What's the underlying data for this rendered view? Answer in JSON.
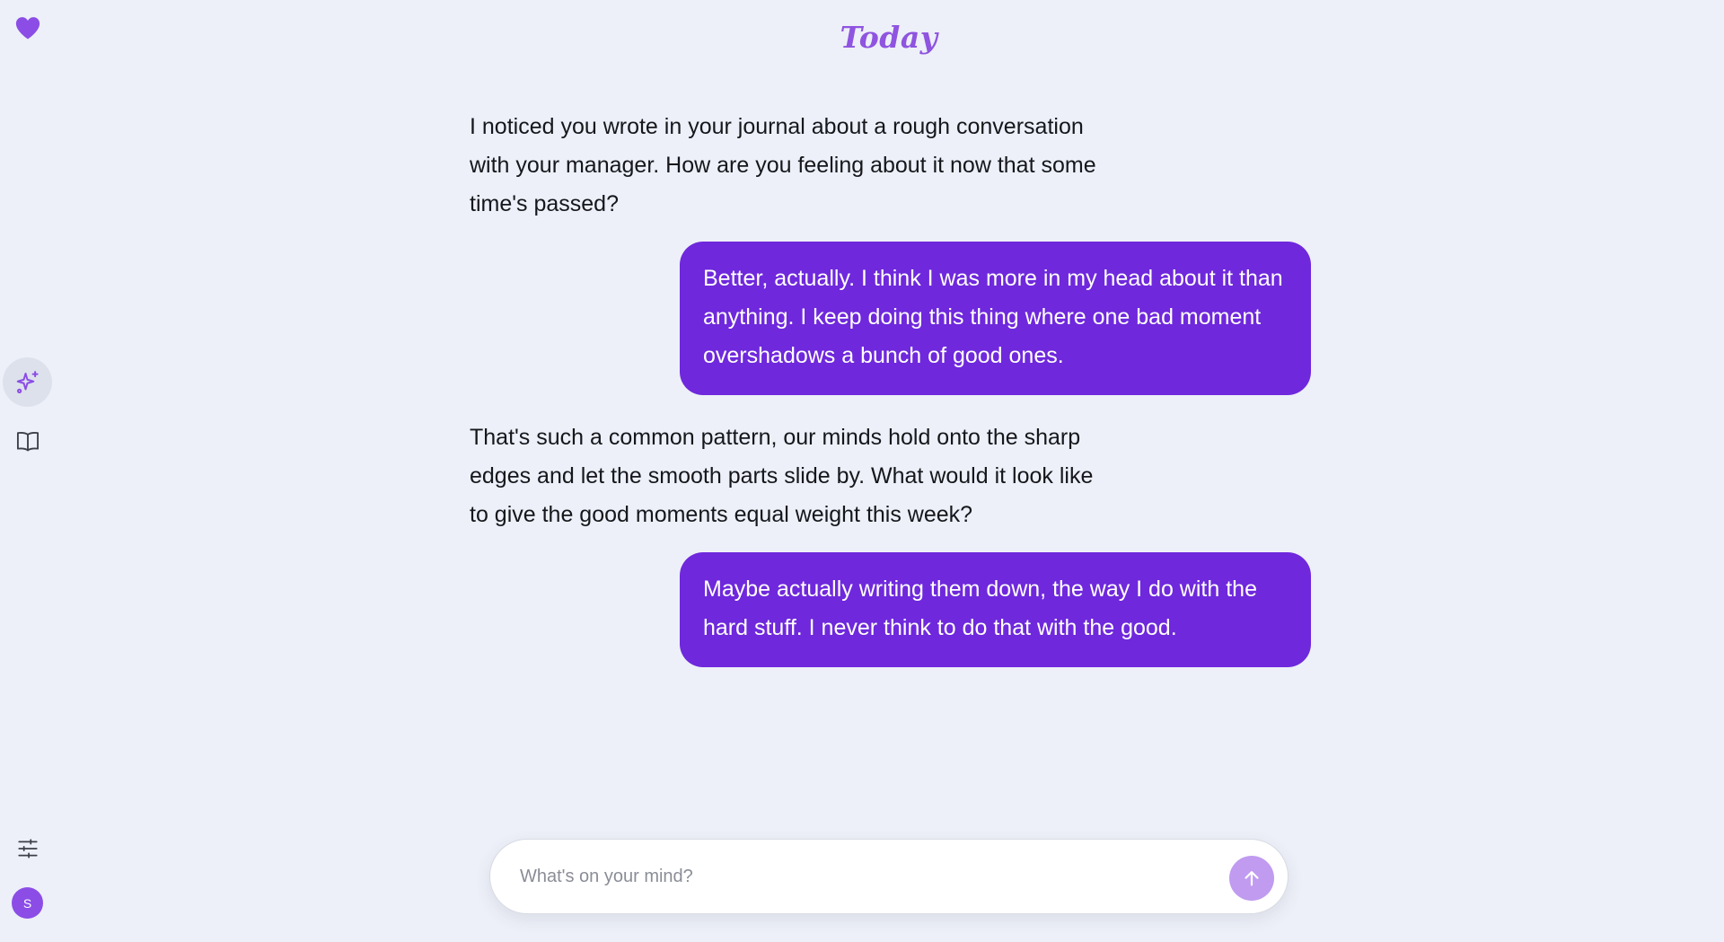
{
  "sidebar": {
    "logo_icon": "heart-icon",
    "nav": [
      {
        "icon": "sparkles-icon",
        "active": true
      },
      {
        "icon": "book-icon",
        "active": false
      }
    ],
    "settings_icon": "sliders-icon",
    "avatar_initial": "S"
  },
  "header": {
    "title": "Today"
  },
  "messages": [
    {
      "role": "assistant",
      "text": "I noticed you wrote in your journal about a rough conversation with your manager. How are you feeling about it now that some time's passed?"
    },
    {
      "role": "user",
      "text": "Better, actually. I think I was more in my head about it than anything. I keep doing this thing where one bad moment overshadows a bunch of good ones."
    },
    {
      "role": "assistant",
      "text": "That's such a common pattern, our minds hold onto the sharp edges and let the smooth parts slide by. What would it look like to give the good moments equal weight this week?"
    },
    {
      "role": "user",
      "text": "Maybe actually writing them down, the way I do with the hard stuff. I never think to do that with the good."
    }
  ],
  "composer": {
    "placeholder": "What's on your mind?",
    "value": "",
    "send_icon": "arrow-up-icon"
  },
  "colors": {
    "background": "#edf0f8",
    "accent": "#6f28dc",
    "title": "#8f54e0",
    "send_button": "#c09bf0",
    "avatar": "#8b4de6"
  }
}
